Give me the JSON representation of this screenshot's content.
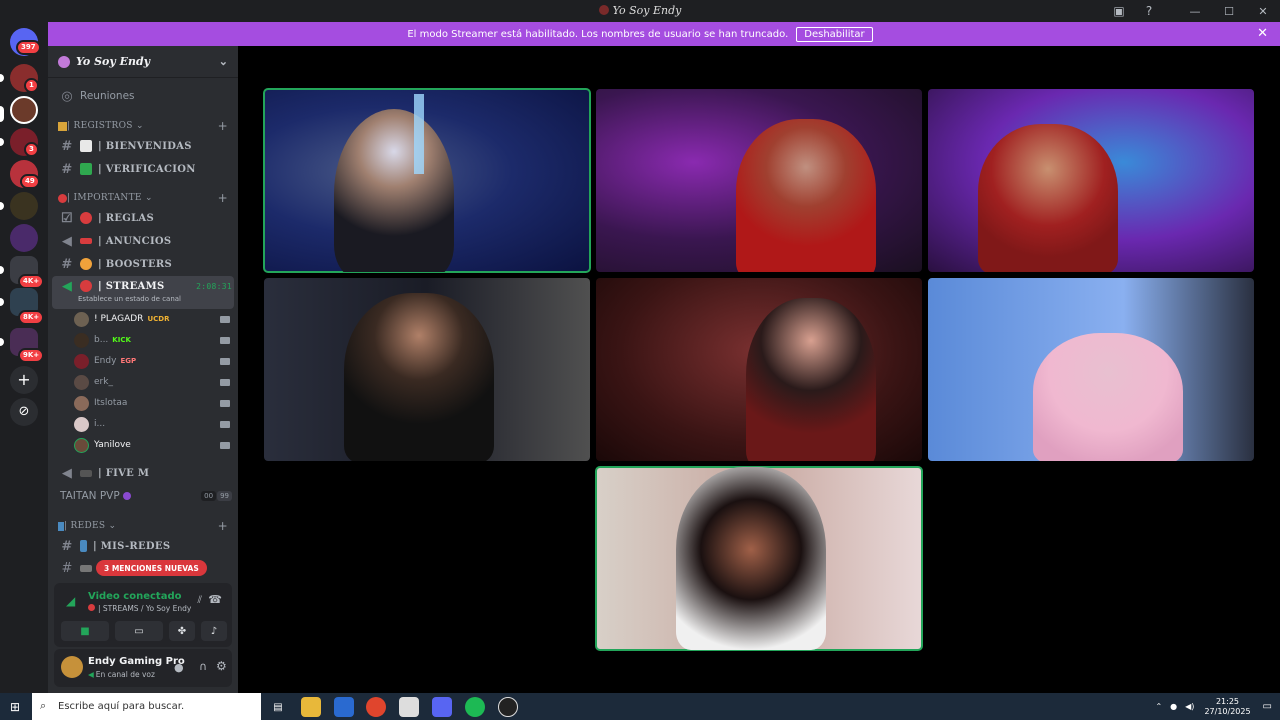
{
  "window": {
    "title": "Yo Soy Endy"
  },
  "banner": {
    "text": "El modo Streamer está habilitado. Los nombres de usuario se han truncado.",
    "button": "Deshabilitar"
  },
  "servers": {
    "home_badge": "397",
    "badges": [
      "1",
      "3",
      "49",
      "4K+",
      "8K+",
      "9K+"
    ]
  },
  "server": {
    "name": "Yo Soy Endy"
  },
  "channels": {
    "reuniones": "Reuniones",
    "cat_registros": "| REGISTROS",
    "bienvenidas": "| BIENVENIDAS",
    "verificacion": "| VERIFICACION",
    "cat_importante": "| IMPORTANTE",
    "reglas": "| REGLAS",
    "anuncios": "| ANUNCIOS",
    "boosters": "| BOOSTERS",
    "streams": "| STREAMS",
    "streams_timer": "2:08:31",
    "streams_status": "Establece un estado de canal",
    "five_m": "| FIVE M",
    "taitan": "TAITAN PVP",
    "taitan_counts": [
      "00",
      "99"
    ],
    "cat_redes": "| REDES",
    "mis_redes": "| MIS-REDES",
    "mentions": "3 MENCIONES NUEVAS"
  },
  "voice_users": [
    {
      "name": "! PLAGADR",
      "tag": "UCDR"
    },
    {
      "name": "b...",
      "tag": "KICK"
    },
    {
      "name": "Endy",
      "tag": "EGP"
    },
    {
      "name": "erk_",
      "tag": ""
    },
    {
      "name": "Itslotaa",
      "tag": ""
    },
    {
      "name": "i...",
      "tag": ""
    },
    {
      "name": "Yanilove",
      "tag": ""
    }
  ],
  "voice_panel": {
    "status": "Video conectado",
    "location": "| STREAMS / Yo Soy Endy"
  },
  "user_panel": {
    "name": "Endy Gaming Pro",
    "status": "En canal de voz"
  },
  "taskbar": {
    "search_placeholder": "Escribe aquí para buscar.",
    "time": "21:25",
    "date": "27/10/2025"
  },
  "colors": {
    "accent": "#a54de0",
    "speaking": "#23a55a",
    "mention": "#da373c"
  }
}
